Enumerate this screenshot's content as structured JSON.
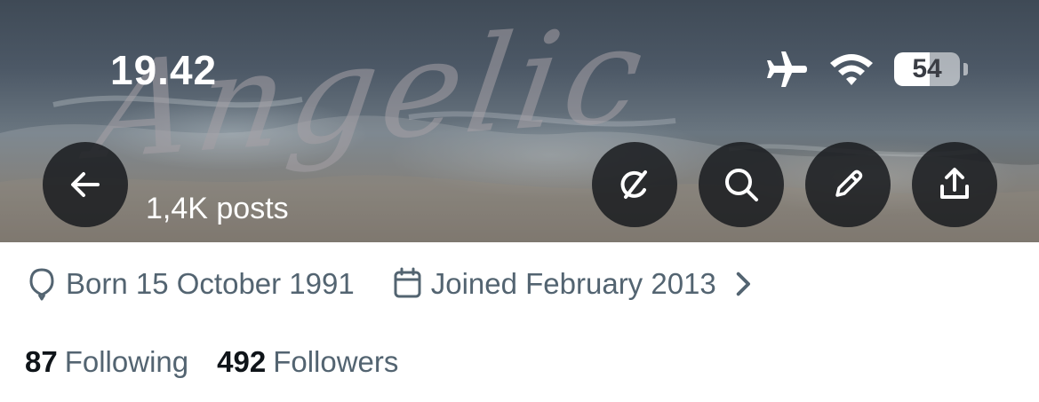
{
  "status_bar": {
    "time": "19.42",
    "battery_level": "54",
    "battery_fraction": 0.54,
    "icons": [
      "airplane-icon",
      "wifi-icon",
      "battery-icon"
    ]
  },
  "banner": {
    "script_text": "Angelic"
  },
  "header": {
    "back_icon": "arrow-left-icon",
    "posts_count": "1,4K posts",
    "actions": [
      "grok-icon",
      "search-icon",
      "pencil-icon",
      "share-icon"
    ]
  },
  "profile": {
    "birth": "Born 15 October 1991",
    "joined": "Joined February 2013",
    "following_count": "87",
    "following_label": "Following",
    "followers_count": "492",
    "followers_label": "Followers"
  },
  "colors": {
    "button_bg": "#1a1c20",
    "meta_text": "#536471",
    "strong_text": "#0f1419"
  }
}
